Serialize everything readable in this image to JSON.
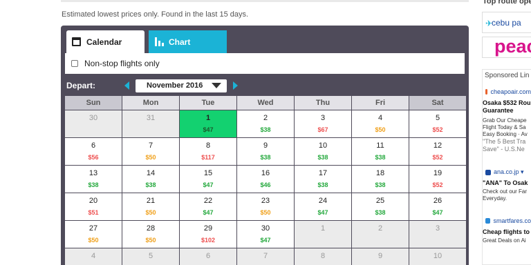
{
  "note": "Estimated lowest prices only. Found in the last 15 days.",
  "tabs": {
    "calendar": "Calendar",
    "chart": "Chart"
  },
  "filter": {
    "nonstop_label": "Non-stop flights only",
    "checked": false
  },
  "depart": {
    "label": "Depart:",
    "month": "November 2016"
  },
  "weekdays": [
    "Sun",
    "Mon",
    "Tue",
    "Wed",
    "Thu",
    "Fri",
    "Sat"
  ],
  "calendar": [
    {
      "day": "30",
      "price": "",
      "state": "other"
    },
    {
      "day": "31",
      "price": "",
      "state": "other"
    },
    {
      "day": "1",
      "price": "$47",
      "state": "selected",
      "tone": "green"
    },
    {
      "day": "2",
      "price": "$38",
      "state": "",
      "tone": "green"
    },
    {
      "day": "3",
      "price": "$67",
      "state": "",
      "tone": "red"
    },
    {
      "day": "4",
      "price": "$50",
      "state": "",
      "tone": "orange"
    },
    {
      "day": "5",
      "price": "$52",
      "state": "",
      "tone": "red"
    },
    {
      "day": "6",
      "price": "$56",
      "state": "",
      "tone": "red"
    },
    {
      "day": "7",
      "price": "$50",
      "state": "",
      "tone": "orange"
    },
    {
      "day": "8",
      "price": "$117",
      "state": "",
      "tone": "red"
    },
    {
      "day": "9",
      "price": "$38",
      "state": "",
      "tone": "green"
    },
    {
      "day": "10",
      "price": "$38",
      "state": "",
      "tone": "green"
    },
    {
      "day": "11",
      "price": "$38",
      "state": "",
      "tone": "green"
    },
    {
      "day": "12",
      "price": "$52",
      "state": "",
      "tone": "red"
    },
    {
      "day": "13",
      "price": "$38",
      "state": "",
      "tone": "green"
    },
    {
      "day": "14",
      "price": "$38",
      "state": "",
      "tone": "green"
    },
    {
      "day": "15",
      "price": "$47",
      "state": "",
      "tone": "green"
    },
    {
      "day": "16",
      "price": "$46",
      "state": "",
      "tone": "green"
    },
    {
      "day": "17",
      "price": "$38",
      "state": "",
      "tone": "green"
    },
    {
      "day": "18",
      "price": "$38",
      "state": "",
      "tone": "green"
    },
    {
      "day": "19",
      "price": "$52",
      "state": "",
      "tone": "red"
    },
    {
      "day": "20",
      "price": "$51",
      "state": "",
      "tone": "red"
    },
    {
      "day": "21",
      "price": "$50",
      "state": "",
      "tone": "orange"
    },
    {
      "day": "22",
      "price": "$47",
      "state": "",
      "tone": "green"
    },
    {
      "day": "23",
      "price": "$50",
      "state": "",
      "tone": "orange"
    },
    {
      "day": "24",
      "price": "$47",
      "state": "",
      "tone": "green"
    },
    {
      "day": "25",
      "price": "$38",
      "state": "",
      "tone": "green"
    },
    {
      "day": "26",
      "price": "$47",
      "state": "",
      "tone": "green"
    },
    {
      "day": "27",
      "price": "$50",
      "state": "",
      "tone": "orange"
    },
    {
      "day": "28",
      "price": "$50",
      "state": "",
      "tone": "orange"
    },
    {
      "day": "29",
      "price": "$102",
      "state": "",
      "tone": "red"
    },
    {
      "day": "30",
      "price": "$47",
      "state": "",
      "tone": "green"
    },
    {
      "day": "1",
      "price": "",
      "state": "other"
    },
    {
      "day": "2",
      "price": "",
      "state": "other"
    },
    {
      "day": "3",
      "price": "",
      "state": "other"
    },
    {
      "day": "4",
      "price": "",
      "state": "other"
    },
    {
      "day": "5",
      "price": "",
      "state": "other"
    },
    {
      "day": "6",
      "price": "",
      "state": "other"
    },
    {
      "day": "7",
      "price": "",
      "state": "other"
    },
    {
      "day": "8",
      "price": "",
      "state": "other"
    },
    {
      "day": "9",
      "price": "",
      "state": "other"
    },
    {
      "day": "10",
      "price": "",
      "state": "other"
    }
  ],
  "sidebar": {
    "heading": "Top route ope",
    "logo1": "cebu pa",
    "logo2": "peac",
    "ads_heading": "Sponsored Lin",
    "ads": [
      {
        "host": "cheapoair.com",
        "title1": "Osaka $532 Rou",
        "title2": "Guarantee",
        "line1": "Grab Our Cheape",
        "line2": "Flight Today & Sa",
        "line3": "Easy Booking · Av",
        "quote1": "\"The 5 Best Tra",
        "quote2": "Save\" - U.S.Ne"
      },
      {
        "host": "ana.co.jp ▾",
        "title1": "\"ANA\" To Osak",
        "line1": "Check out our Far",
        "line2": "Everyday."
      },
      {
        "host": "smartfares.co",
        "title1": "Cheap flights to",
        "line1": "Great Deals on Ai"
      }
    ]
  }
}
